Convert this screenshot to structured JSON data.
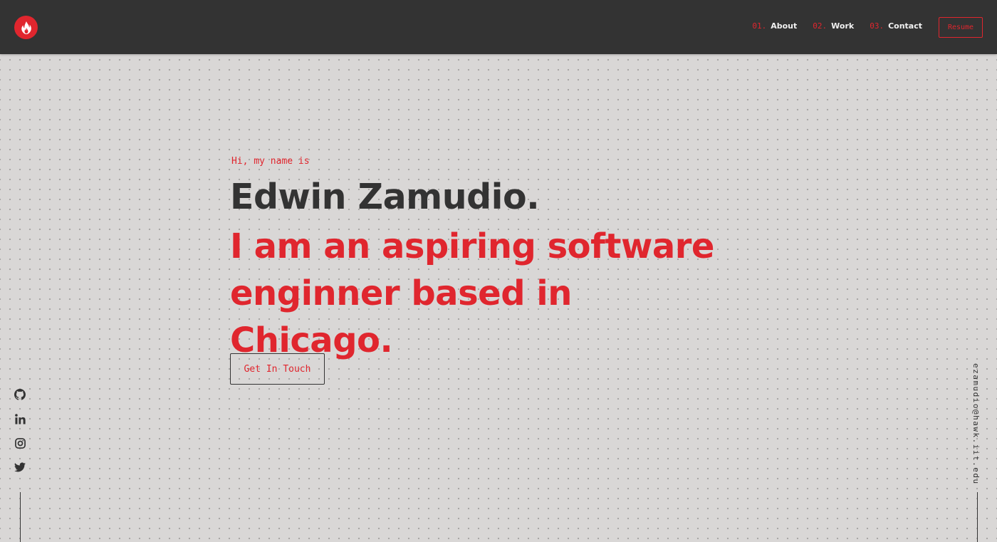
{
  "nav": {
    "items": [
      {
        "num": "01.",
        "label": "About"
      },
      {
        "num": "02.",
        "label": "Work"
      },
      {
        "num": "03.",
        "label": "Contact"
      }
    ],
    "resume_label": "Resume"
  },
  "hero": {
    "greeting": "Hi, my name is",
    "name": "Edwin Zamudio.",
    "tagline": "I am an aspiring software enginner based in Chicago.",
    "cta_label": "Get In Touch"
  },
  "social": [
    "github-icon",
    "linkedin-icon",
    "instagram-icon",
    "twitter-icon"
  ],
  "email": "ezamudio@hawk.iit.edu",
  "colors": {
    "accent": "#e0262e",
    "navbar": "#333333",
    "background": "#d9d7d6",
    "text_dark": "#333333"
  }
}
